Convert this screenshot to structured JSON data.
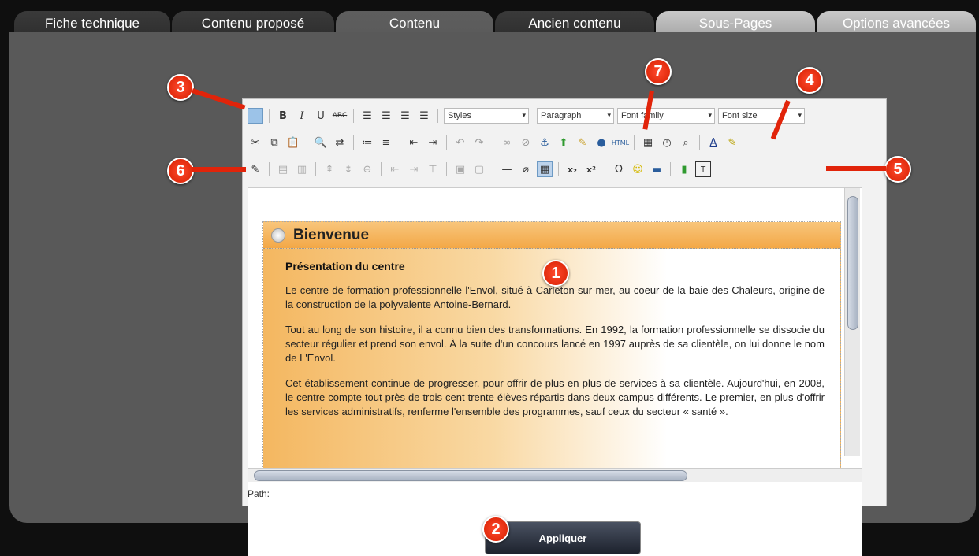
{
  "tabs": [
    {
      "label": "Fiche technique",
      "state": "dark"
    },
    {
      "label": "Contenu proposé",
      "state": "dark"
    },
    {
      "label": "Contenu",
      "state": "active"
    },
    {
      "label": "Ancien contenu",
      "state": "dark"
    },
    {
      "label": "Sous-Pages",
      "state": "light"
    },
    {
      "label": "Options avancées",
      "state": "light"
    }
  ],
  "toolbar": {
    "styles": "Styles",
    "paragraph": "Paragraph",
    "font_family": "Font family",
    "font_size": "Font size"
  },
  "document": {
    "title": "Bienvenue",
    "heading": "Présentation du centre",
    "paragraphs": [
      "Le centre de formation professionnelle l'Envol, situé à Carleton-sur-mer, au coeur de la baie des Chaleurs, origine de la construction de la polyvalente Antoine-Bernard.",
      "Tout au long de son histoire, il a connu bien des transformations. En 1992, la formation professionnelle se dissocie du secteur régulier et prend son envol. À la suite d'un concours lancé en 1997 auprès de sa clientèle, on lui donne le nom de L'Envol.",
      "Cet établissement continue de progresser, pour offrir de plus en plus de services à sa clientèle. Aujourd'hui, en 2008, le centre compte tout près de trois cent trente élèves répartis dans deux campus différents. Le premier, en plus d'offrir les services administratifs, renferme l'ensemble des programmes, sauf ceux du secteur « santé »."
    ]
  },
  "status": {
    "path": "Path:"
  },
  "apply_label": "Appliquer",
  "callouts": [
    "1",
    "2",
    "3",
    "4",
    "5",
    "6",
    "7"
  ],
  "colors": {
    "accent": "#d51e00",
    "doc_gradient": "#f4b760"
  }
}
